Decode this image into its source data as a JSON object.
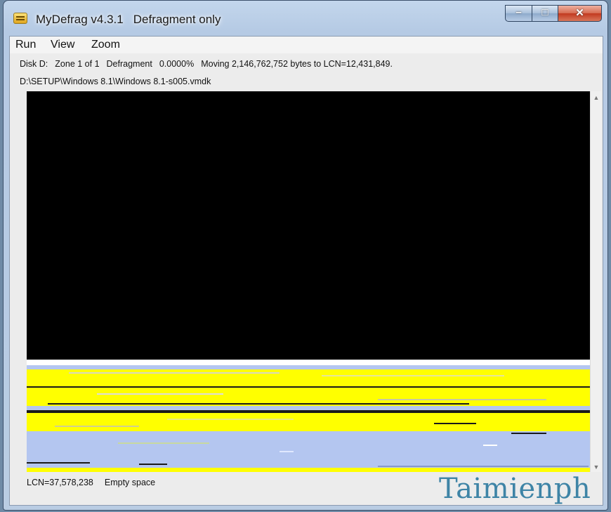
{
  "window": {
    "title": "MyDefrag v4.3.1",
    "mode": "Defragment only",
    "minimize_glyph": "–",
    "maximize_glyph": "□",
    "close_glyph": "✕"
  },
  "menu": [
    "Run",
    "View",
    "Zoom"
  ],
  "status": {
    "disk": "Disk D:",
    "zone": "Zone 1 of 1",
    "action": "Defragment",
    "percent": "0.0000%",
    "message": "Moving 2,146,762,752 bytes to LCN=12,431,849.",
    "file_path": "D:\\SETUP\\Windows 8.1\\Windows 8.1-s005.vmdk"
  },
  "footer": {
    "lcn": "LCN=37,578,238",
    "info": "Empty space"
  },
  "scrollbar": {
    "up_arrow": "▲",
    "down_arrow": "▼"
  },
  "watermark": "Taimienph",
  "colors": {
    "empty": "#000000",
    "allocated": "#ffff00",
    "unfragmented": "#b4c6f0",
    "moving": "#ffffff",
    "border_line": "#1a1a1a"
  }
}
